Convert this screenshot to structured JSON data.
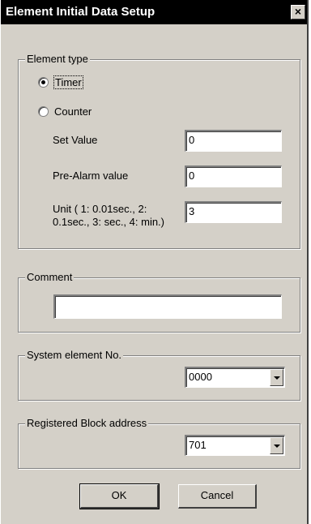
{
  "dialog": {
    "title": "Element Initial Data Setup",
    "close_glyph": "×",
    "close_icon": "close-icon"
  },
  "element_type": {
    "group_label": "Element type",
    "options": [
      {
        "label": "Timer",
        "selected": true
      },
      {
        "label": "Counter",
        "selected": false
      }
    ],
    "set_value": {
      "label": "Set Value",
      "value": "0"
    },
    "pre_alarm": {
      "label": "Pre-Alarm value",
      "value": "0"
    },
    "unit": {
      "label": "Unit ( 1: 0.01sec., 2: 0.1sec., 3: sec., 4: min.)",
      "value": "3"
    }
  },
  "comment": {
    "group_label": "Comment",
    "value": ""
  },
  "system_element": {
    "group_label": "System element No.",
    "selected": "0000",
    "dropdown_icon": "chevron-down-icon"
  },
  "registered_block": {
    "group_label": "Registered Block address",
    "selected": "701",
    "dropdown_icon": "chevron-down-icon"
  },
  "buttons": {
    "ok": "OK",
    "cancel": "Cancel"
  }
}
